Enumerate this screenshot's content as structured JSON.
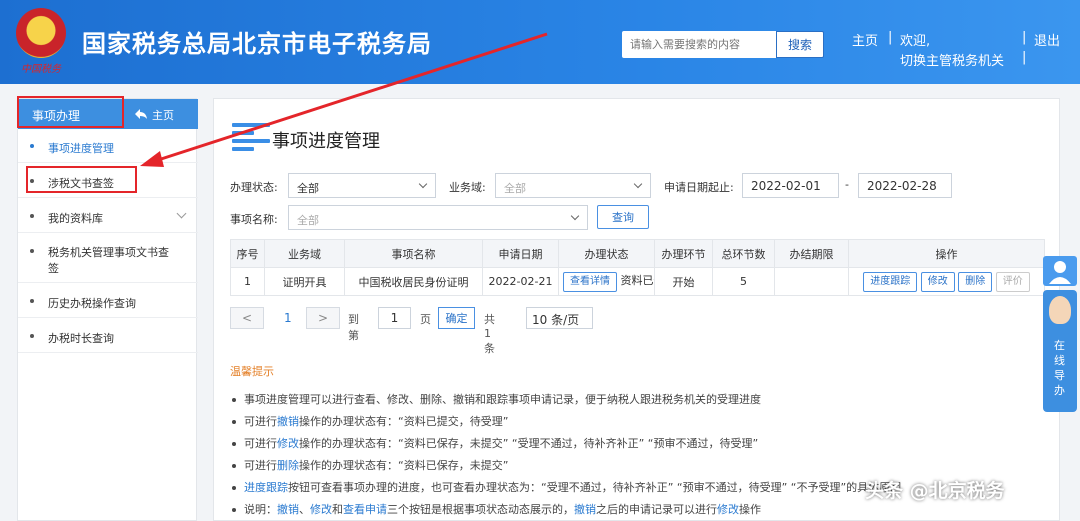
{
  "header": {
    "title": "国家税务总局北京市电子税务局",
    "emblem_text": "中国税务",
    "search_placeholder": "请输入需要搜索的内容",
    "search_button": "搜索",
    "home_link": "主页",
    "welcome": "欢迎,",
    "switch_agency": "切换主管税务机关",
    "logout": "退出",
    "sep": "|"
  },
  "sidebar": {
    "header_label": "事项办理",
    "home_label": "主页",
    "items": [
      {
        "label": "事项进度管理"
      },
      {
        "label": "涉税文书查签"
      },
      {
        "label": "我的资料库"
      },
      {
        "label": "税务机关管理事项文书查签"
      },
      {
        "label": "历史办税操作查询"
      },
      {
        "label": "办税时长查询"
      }
    ]
  },
  "main": {
    "title": "事项进度管理",
    "filters": {
      "status_label": "办理状态:",
      "status_value": "全部",
      "domain_label": "业务域:",
      "domain_value": "全部",
      "date_label": "申请日期起止:",
      "date_start": "2022-02-01",
      "date_dash": "-",
      "date_end": "2022-02-28",
      "name_label": "事项名称:",
      "name_value": "全部",
      "query_button": "查询"
    },
    "table": {
      "headers": [
        "序号",
        "业务域",
        "事项名称",
        "申请日期",
        "办理状态",
        "办理环节",
        "总环节数",
        "办结期限",
        "操作"
      ],
      "rows": [
        {
          "index": "1",
          "domain": "证明开具",
          "name": "中国税收居民身份证明",
          "date": "2022-02-21",
          "status_button": "查看详情",
          "status_text": "资料已保",
          "stage": "开始",
          "total": "5",
          "deadline": "",
          "actions": [
            "进度跟踪",
            "修改",
            "删除",
            "评价"
          ]
        }
      ]
    },
    "pager": {
      "prev": "<",
      "page": "1",
      "next": ">",
      "goto_label": "到第",
      "goto_value": "1",
      "page_unit": "页",
      "confirm": "确定",
      "total": "共 1 条",
      "page_size": "10 条/页"
    },
    "tips": {
      "title": "温馨提示",
      "lines": [
        {
          "parts": [
            {
              "t": "事项进度管理可以进行查看、修改、删除、撤销和跟踪事项申请记录，便于纳税人跟进税务机关的受理进度"
            }
          ]
        },
        {
          "parts": [
            {
              "t": "可进行"
            },
            {
              "t": "撤销",
              "link": true
            },
            {
              "t": "操作的办理状态有：“资料已提交，待受理”"
            }
          ]
        },
        {
          "parts": [
            {
              "t": "可进行"
            },
            {
              "t": "修改",
              "link": true
            },
            {
              "t": "操作的办理状态有：“资料已保存，未提交” “受理不通过，待补齐补正” “预审不通过，待受理”"
            }
          ]
        },
        {
          "parts": [
            {
              "t": "可进行"
            },
            {
              "t": "删除",
              "link": true
            },
            {
              "t": "操作的办理状态有：“资料已保存，未提交”"
            }
          ]
        },
        {
          "parts": [
            {
              "t": "进度跟踪",
              "link": true
            },
            {
              "t": "按钮可查看事项办理的进度，也可查看办理状态为：“受理不通过，待补齐补正” “预审不通过，待受理” “不予受理”的具体原因"
            }
          ]
        },
        {
          "parts": [
            {
              "t": "说明："
            },
            {
              "t": "撤销",
              "link": true
            },
            {
              "t": "、"
            },
            {
              "t": "修改",
              "link": true
            },
            {
              "t": "和"
            },
            {
              "t": "查看申请",
              "link": true
            },
            {
              "t": "三个按钮是根据事项状态动态展示的，"
            },
            {
              "t": "撤销",
              "link": true
            },
            {
              "t": "之后的申请记录可以进行"
            },
            {
              "t": "修改",
              "link": true
            },
            {
              "t": "操作"
            }
          ]
        }
      ]
    }
  },
  "float_widget": {
    "label": "在线导办"
  },
  "watermark": "头条 @北京税务",
  "colors": {
    "header_blue": "#2a85e6",
    "accent": "#2a7ad0",
    "annotation_red": "#e4252a",
    "tip_title": "#e4812a"
  }
}
